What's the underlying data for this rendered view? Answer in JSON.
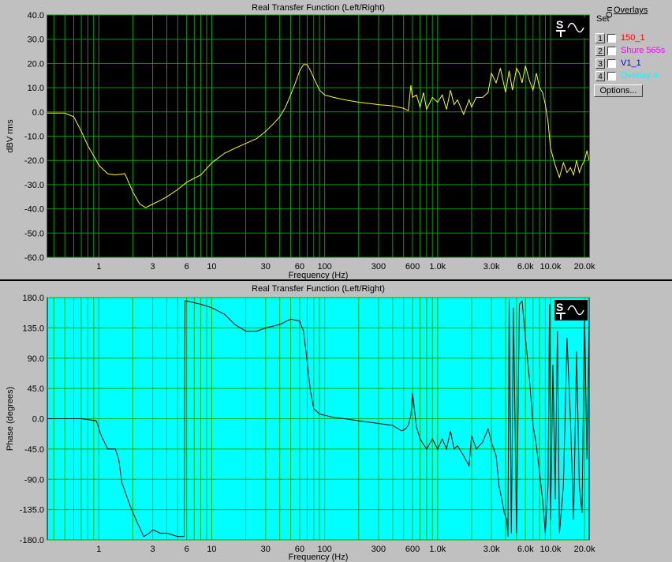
{
  "colors": {
    "plot1_bg": "#000000",
    "plot1_grid": "#00a000",
    "plot1_trace": "#ffff00",
    "plot2_bg": "#00ffff",
    "plot2_grid": "#00b000",
    "plot2_trace": "#000000"
  },
  "overlays": {
    "set_label": "Set",
    "on_label": "On",
    "title": "Overlays",
    "items": [
      {
        "num": "1",
        "name": "150_1",
        "color": "#ff0000",
        "checked": false
      },
      {
        "num": "2",
        "name": "Shure 565s",
        "color": "#ff00ff",
        "checked": false
      },
      {
        "num": "3",
        "name": "V1_1",
        "color": "#0000ff",
        "checked": false
      },
      {
        "num": "4",
        "name": "Overlay 4",
        "color": "#00ffff",
        "checked": false
      }
    ],
    "options_label": "Options..."
  },
  "chart_data": [
    {
      "type": "line",
      "title": "Real Transfer Function (Left/Right)",
      "xlabel": "Frequency (Hz)",
      "ylabel": "dBV rms",
      "xscale": "log",
      "xlim": [
        0.35,
        22000
      ],
      "ylim": [
        -60,
        40
      ],
      "grid": true,
      "logo_icon": "st-sine-logo-icon",
      "xticks": [
        {
          "v": 1,
          "label": "1"
        },
        {
          "v": 3,
          "label": "3"
        },
        {
          "v": 6,
          "label": "6"
        },
        {
          "v": 10,
          "label": "10"
        },
        {
          "v": 30,
          "label": "30"
        },
        {
          "v": 60,
          "label": "60"
        },
        {
          "v": 100,
          "label": "100"
        },
        {
          "v": 300,
          "label": "300"
        },
        {
          "v": 600,
          "label": "600"
        },
        {
          "v": 1000,
          "label": "1.0k"
        },
        {
          "v": 3000,
          "label": "3.0k"
        },
        {
          "v": 6000,
          "label": "6.0k"
        },
        {
          "v": 10000,
          "label": "10.0k"
        },
        {
          "v": 20000,
          "label": "20.0k"
        }
      ],
      "yticks": [
        {
          "v": 40,
          "label": "40.0"
        },
        {
          "v": 30,
          "label": "30.0"
        },
        {
          "v": 20,
          "label": "20.0"
        },
        {
          "v": 10,
          "label": "10.0"
        },
        {
          "v": 0,
          "label": "0.0"
        },
        {
          "v": -10,
          "label": "-10.0"
        },
        {
          "v": -20,
          "label": "-20.0"
        },
        {
          "v": -30,
          "label": "-30.0"
        },
        {
          "v": -40,
          "label": "-40.0"
        },
        {
          "v": -50,
          "label": "-50.0"
        },
        {
          "v": -60,
          "label": "-60.0"
        }
      ],
      "x": [
        0.35,
        0.5,
        0.6,
        0.7,
        0.8,
        0.9,
        1.0,
        1.2,
        1.4,
        1.7,
        2.0,
        2.3,
        2.6,
        3.0,
        3.5,
        4,
        5,
        6,
        8,
        10,
        13,
        16,
        20,
        25,
        30,
        35,
        40,
        45,
        50,
        55,
        60,
        65,
        70,
        75,
        80,
        90,
        100,
        120,
        150,
        200,
        250,
        300,
        400,
        500,
        550,
        580,
        600,
        650,
        700,
        750,
        800,
        900,
        1000,
        1100,
        1200,
        1300,
        1400,
        1500,
        1700,
        1900,
        2000,
        2200,
        2500,
        2800,
        3000,
        3300,
        3600,
        4000,
        4300,
        4600,
        5000,
        5300,
        5600,
        6000,
        6500,
        7000,
        7500,
        8000,
        8500,
        9000,
        9500,
        10000,
        11000,
        12000,
        13000,
        14000,
        15000,
        16000,
        17000,
        18000,
        19000,
        20000,
        21000,
        22000
      ],
      "y": [
        -0.5,
        -0.5,
        -2,
        -8,
        -14,
        -18,
        -22,
        -25.5,
        -26,
        -25.5,
        -33,
        -38,
        -39.5,
        -38,
        -36.5,
        -35,
        -32,
        -29,
        -26,
        -21,
        -17,
        -15,
        -13,
        -11,
        -8,
        -5,
        -2,
        2,
        7,
        12,
        17,
        19.5,
        19.5,
        17,
        14,
        9,
        7,
        6,
        5,
        4,
        3.5,
        3,
        2.5,
        1.5,
        0.5,
        11,
        6,
        7,
        2,
        8,
        1,
        6,
        4,
        7,
        1,
        9,
        3,
        5,
        -1,
        5,
        2,
        6,
        6,
        8,
        16,
        12,
        18,
        8,
        17,
        9,
        18,
        16,
        12,
        19,
        13,
        9,
        16,
        10,
        8,
        3,
        -4,
        -15,
        -22,
        -27,
        -21,
        -25,
        -23,
        -26,
        -20,
        -25,
        -22,
        -20,
        -16,
        -20
      ],
      "series_color": "#ffff00"
    },
    {
      "type": "line",
      "title": "Real Transfer Function (Left/Right)",
      "xlabel": "Frequency (Hz)",
      "ylabel": "Phase (degrees)",
      "xscale": "log",
      "xlim": [
        0.35,
        22000
      ],
      "ylim": [
        -180,
        180
      ],
      "grid": true,
      "logo_icon": "st-sine-logo-icon",
      "xticks": [
        {
          "v": 1,
          "label": "1"
        },
        {
          "v": 3,
          "label": "3"
        },
        {
          "v": 6,
          "label": "6"
        },
        {
          "v": 10,
          "label": "10"
        },
        {
          "v": 30,
          "label": "30"
        },
        {
          "v": 60,
          "label": "60"
        },
        {
          "v": 100,
          "label": "100"
        },
        {
          "v": 300,
          "label": "300"
        },
        {
          "v": 600,
          "label": "600"
        },
        {
          "v": 1000,
          "label": "1.0k"
        },
        {
          "v": 3000,
          "label": "3.0k"
        },
        {
          "v": 6000,
          "label": "6.0k"
        },
        {
          "v": 10000,
          "label": "10.0k"
        },
        {
          "v": 20000,
          "label": "20.0k"
        }
      ],
      "yticks": [
        {
          "v": 180,
          "label": "180.0"
        },
        {
          "v": 135,
          "label": "135.0"
        },
        {
          "v": 90,
          "label": "90.0"
        },
        {
          "v": 45,
          "label": "45.0"
        },
        {
          "v": 0,
          "label": "0.0"
        },
        {
          "v": -45,
          "label": "-45.0"
        },
        {
          "v": -90,
          "label": "-90.0"
        },
        {
          "v": -135,
          "label": "-135.0"
        },
        {
          "v": -180,
          "label": "-180.0"
        }
      ],
      "x": [
        0.35,
        0.7,
        0.95,
        1.05,
        1.2,
        1.4,
        1.5,
        1.6,
        1.9,
        2.2,
        2.5,
        2.8,
        3.0,
        3.5,
        4,
        5,
        5.7,
        5.8,
        6,
        8,
        10,
        13,
        16,
        20,
        25,
        30,
        40,
        50,
        60,
        65,
        70,
        75,
        80,
        90,
        100,
        120,
        150,
        200,
        300,
        400,
        480,
        520,
        550,
        580,
        600,
        650,
        700,
        750,
        800,
        900,
        1000,
        1100,
        1200,
        1300,
        1400,
        1500,
        1700,
        1900,
        2000,
        2200,
        2500,
        2800,
        3000,
        3300,
        3500,
        3700,
        3900,
        4000,
        4100,
        4200,
        4300,
        4500,
        4700,
        5000,
        5300,
        5600,
        6000,
        6500,
        7000,
        7500,
        8000,
        8500,
        9000,
        9500,
        9800,
        10000,
        10500,
        11000,
        11500,
        12000,
        13000,
        14000,
        15000,
        16000,
        17000,
        18000,
        19000,
        20000,
        21000,
        22000
      ],
      "y": [
        0,
        0,
        -3,
        -25,
        -45,
        -45,
        -60,
        -95,
        -130,
        -155,
        -175,
        -170,
        -165,
        -170,
        -170,
        -175,
        -175,
        175,
        175,
        170,
        165,
        155,
        140,
        130,
        130,
        135,
        140,
        148,
        145,
        130,
        85,
        40,
        15,
        7,
        5,
        2,
        0,
        -3,
        -7,
        -10,
        -18,
        -15,
        -10,
        5,
        38,
        -12,
        -30,
        -38,
        -45,
        -30,
        -45,
        -30,
        -45,
        -18,
        -45,
        -40,
        -55,
        -70,
        -25,
        -45,
        -35,
        -15,
        -35,
        -55,
        -100,
        -120,
        -140,
        -145,
        -150,
        -175,
        178,
        -170,
        165,
        -170,
        170,
        175,
        120,
        60,
        -10,
        -40,
        -80,
        -120,
        -170,
        -100,
        170,
        -150,
        80,
        -120,
        130,
        -170,
        -100,
        120,
        0,
        -150,
        100,
        -100,
        -140,
        160,
        -60,
        140
      ],
      "series_color": "#000000"
    }
  ]
}
